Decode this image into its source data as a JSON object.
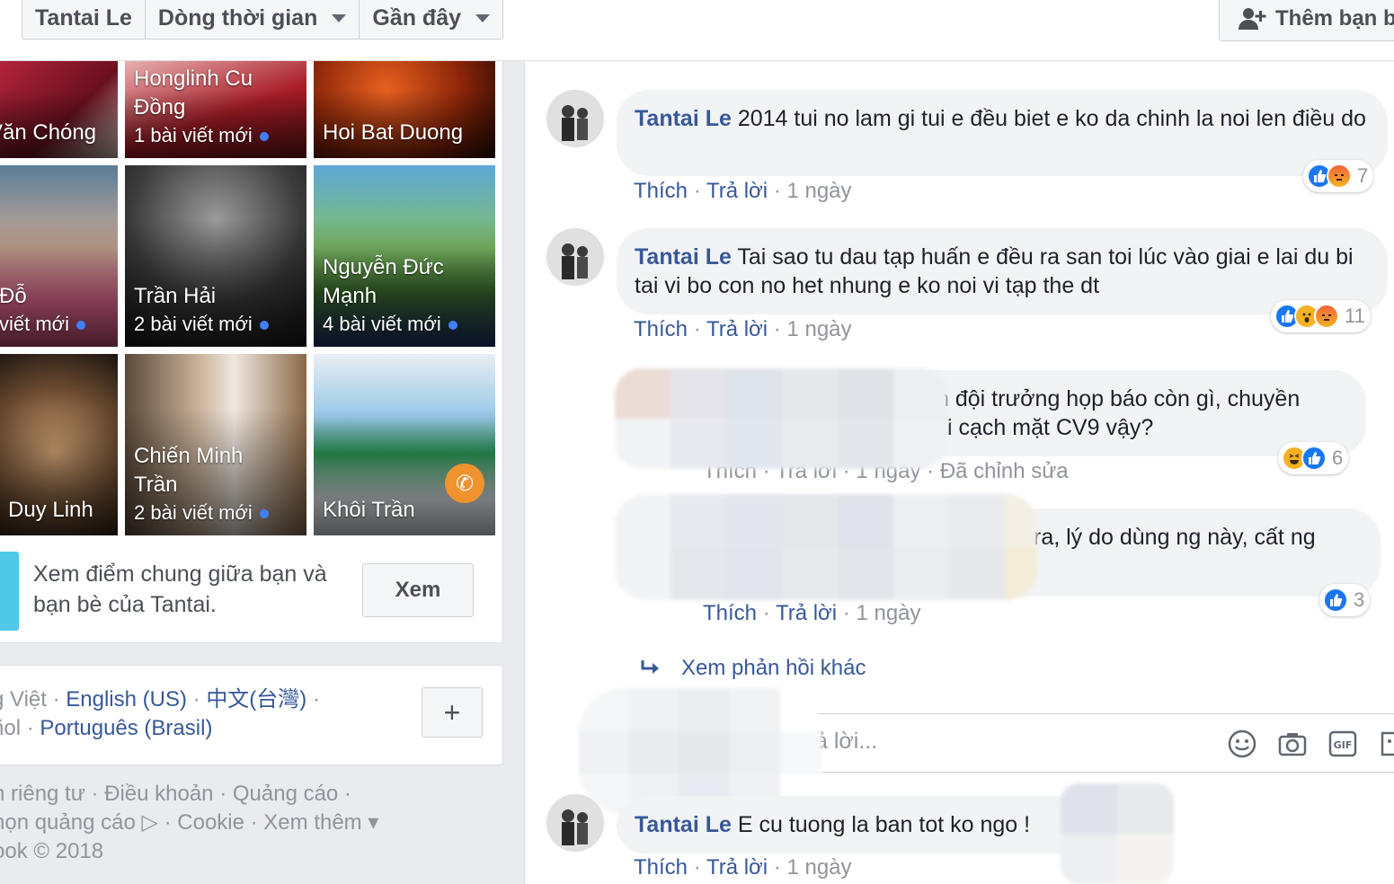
{
  "header": {
    "crumbs": [
      "Tantai Le",
      "Dòng thời gian",
      "Gần đây"
    ],
    "add_friend_label": "Thêm bạn b"
  },
  "friends": [
    {
      "name": "Văn Chóng",
      "posts": ""
    },
    {
      "name": "Honglinh Cu Đồng",
      "posts": "1 bài viết mới"
    },
    {
      "name": "Hoi Bat Duong",
      "posts": ""
    },
    {
      "name": "Đỗ",
      "posts": "viết mới"
    },
    {
      "name": "Trần Hải",
      "posts": "2 bài viết mới"
    },
    {
      "name": "Nguyễn Đức Mạnh",
      "posts": "4 bài viết mới"
    },
    {
      "name": "Duy Linh",
      "posts": ""
    },
    {
      "name": "Chiến Minh Trần",
      "posts": "2 bài viết mới"
    },
    {
      "name": "Khôi Trần",
      "posts": ""
    }
  ],
  "mutual": {
    "text": "Xem điểm chung giữa bạn và bạn bè của Tantai.",
    "button": "Xem"
  },
  "languages": {
    "line1_prefix": "g Việt · ",
    "line1_links": [
      "English (US)",
      "中文(台灣)"
    ],
    "line2_prefix": "ñol · ",
    "line2_link": "Português (Brasil)",
    "plus": "+"
  },
  "footer": {
    "line1": "n riêng tư · Điều khoản · Quảng cáo ·",
    "line2": "họn quảng cáo ▷ · Cookie · Xem thêm ▾",
    "line3": "ook © 2018"
  },
  "comments": [
    {
      "author": "Tantai Le",
      "text": "2014 tui no lam gi tui e đều biet e ko da chinh la noi len điều do",
      "like": "Thích",
      "reply": "Trả lời",
      "time": "1 ngày",
      "reactions": [
        "like",
        "angry"
      ],
      "reaction_count": "7"
    },
    {
      "author": "Tantai Le",
      "text": "Tai sao tu dau tạp huấn e đều ra san toi lúc vào giai e lai du bi tai vi bo con no het nhung e ko noi vi tạp the dt",
      "like": "Thích",
      "reply": "Trả lời",
      "time": "1 ngày",
      "reactions": [
        "like",
        "wow",
        "angry"
      ],
      "reaction_count": "11"
    },
    {
      "author": "Tantai Le",
      "text": "E cu tuong la ban tot ko ngo !",
      "like": "Thích",
      "reply": "Trả lời",
      "time": "1 ngày"
    }
  ],
  "replies": [
    {
      "text_line1": "n đội trưởng họp báo còn gì, chuyền",
      "text_line2": "i cạch mặt CV9 vậy?",
      "actions": "Thích · Trả lời · 1 ngày · Đã chỉnh sửa",
      "reactions": [
        "haha",
        "like"
      ],
      "reaction_count": "6"
    },
    {
      "text_line1": "ra, lý do dùng ng này, cất ng",
      "like": "Thích",
      "reply": "Trả lời",
      "time": "1 ngày",
      "reactions": [
        "like"
      ],
      "reaction_count": "3"
    }
  ],
  "more_replies": "Xem phản hồi khác",
  "reply_placeholder": "ả lời..."
}
